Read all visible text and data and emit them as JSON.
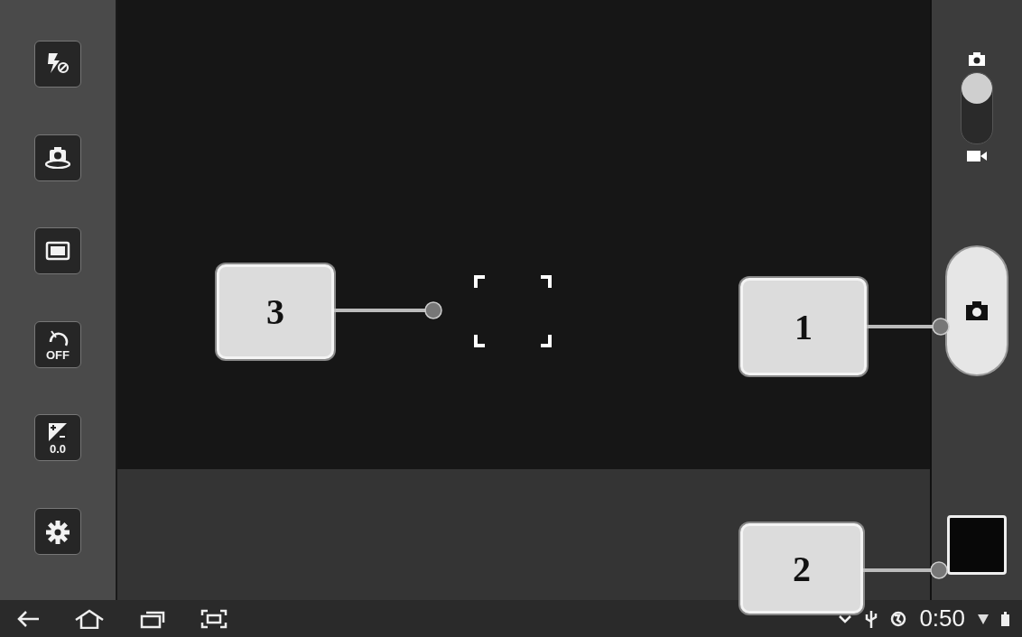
{
  "left_toolbar": [
    {
      "kind": "flash-off"
    },
    {
      "kind": "self-shot"
    },
    {
      "kind": "aspect"
    },
    {
      "kind": "timer",
      "label": "OFF"
    },
    {
      "kind": "exposure",
      "label": "0.0"
    },
    {
      "kind": "settings"
    }
  ],
  "mode_switch": {
    "video": false
  },
  "callouts": [
    {
      "label": "1"
    },
    {
      "label": "2"
    },
    {
      "label": "3"
    }
  ],
  "status_bar": {
    "time": "0:50"
  }
}
